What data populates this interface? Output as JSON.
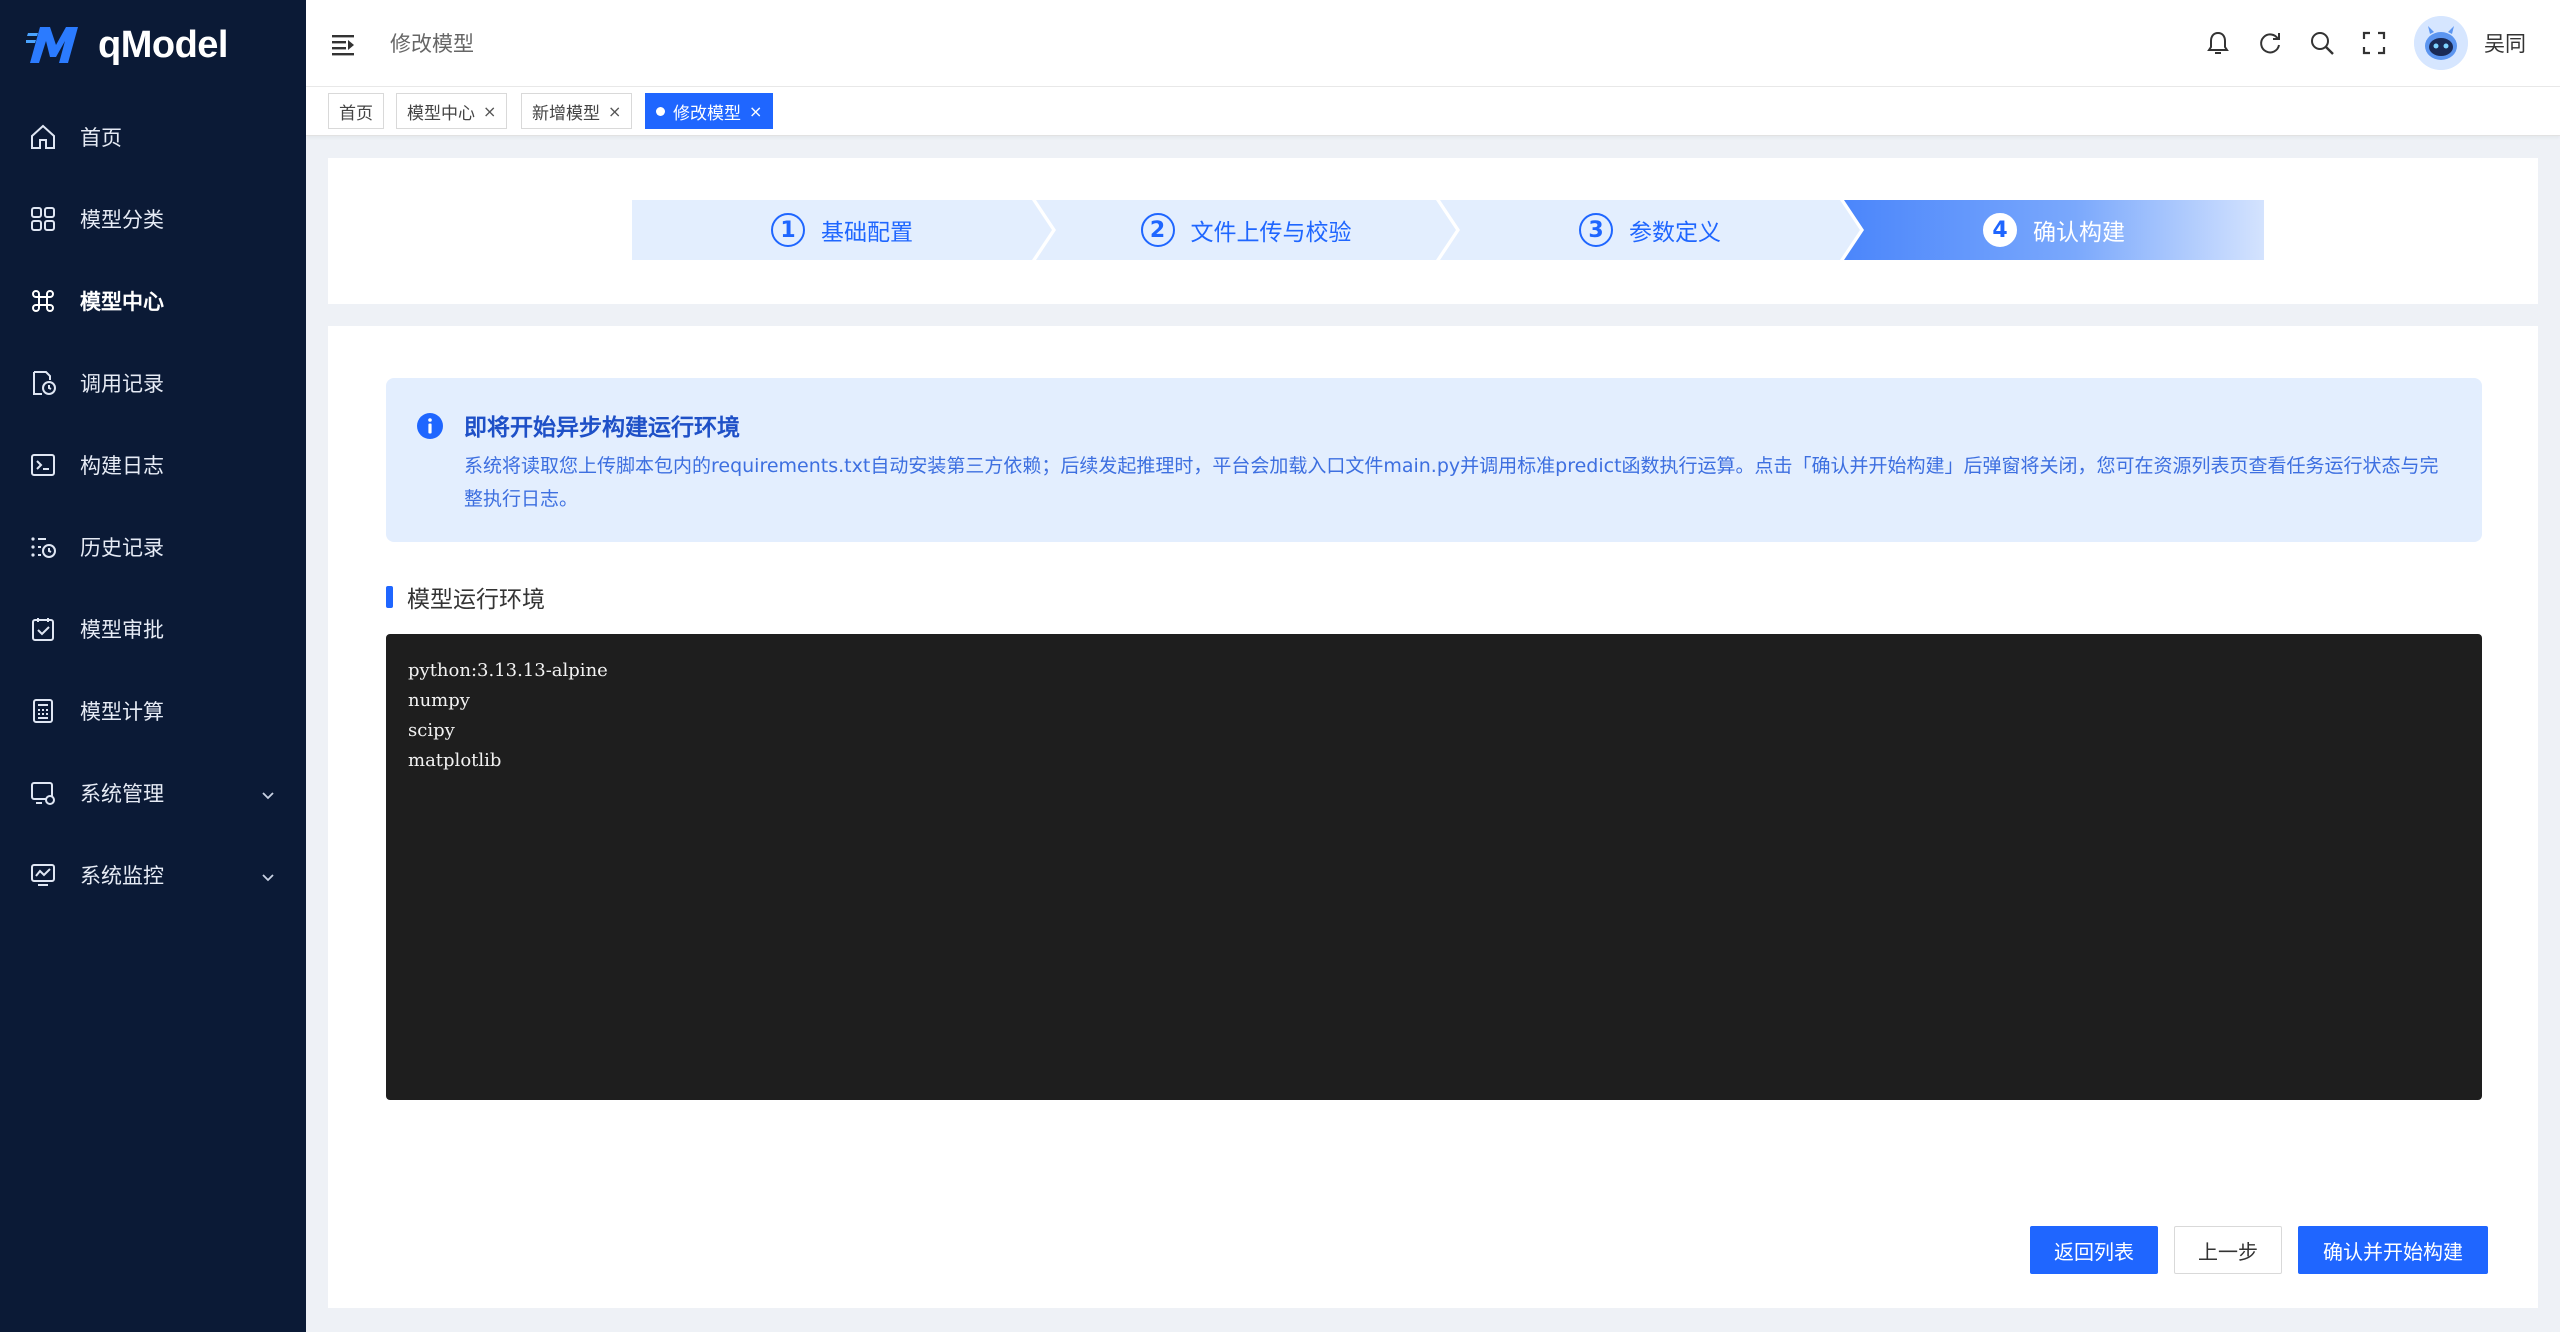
{
  "app": {
    "name": "qModel",
    "user": "吴同",
    "breadcrumb": "修改模型"
  },
  "sidebar": {
    "items": [
      {
        "label": "首页",
        "icon": "home-icon"
      },
      {
        "label": "模型分类",
        "icon": "grid-icon"
      },
      {
        "label": "模型中心",
        "icon": "command-icon",
        "active": true
      },
      {
        "label": "调用记录",
        "icon": "document-clock-icon"
      },
      {
        "label": "构建日志",
        "icon": "terminal-icon"
      },
      {
        "label": "历史记录",
        "icon": "history-list-icon"
      },
      {
        "label": "模型审批",
        "icon": "approval-icon"
      },
      {
        "label": "模型计算",
        "icon": "calculator-icon"
      },
      {
        "label": "系统管理",
        "icon": "system-settings-icon",
        "expandable": true
      },
      {
        "label": "系统监控",
        "icon": "monitor-icon",
        "expandable": true
      }
    ]
  },
  "tabs": [
    {
      "label": "首页",
      "closable": false
    },
    {
      "label": "模型中心",
      "closable": true
    },
    {
      "label": "新增模型",
      "closable": true
    },
    {
      "label": "修改模型",
      "closable": true,
      "active": true
    }
  ],
  "tab_close_glyph": "×",
  "steps": [
    {
      "number": "1",
      "label": "基础配置"
    },
    {
      "number": "2",
      "label": "文件上传与校验"
    },
    {
      "number": "3",
      "label": "参数定义"
    },
    {
      "number": "4",
      "label": "确认构建",
      "current": true
    }
  ],
  "alert": {
    "title": "即将开始异步构建运行环境",
    "description": "系统将读取您上传脚本包内的requirements.txt自动安装第三方依赖；后续发起推理时，平台会加载入口文件main.py并调用标准predict函数执行运算。点击「确认并开始构建」后弹窗将关闭，您可在资源列表页查看任务运行状态与完整执行日志。"
  },
  "section": {
    "title": "模型运行环境"
  },
  "environment_lines": [
    "python:3.13.13-alpine",
    "numpy",
    "scipy",
    "matplotlib"
  ],
  "buttons": {
    "back": "返回列表",
    "prev": "上一步",
    "confirm": "确认并开始构建"
  },
  "watermark": "qModel",
  "colors": {
    "primary": "#1f66ff",
    "sidebar_bg": "#0b1a36",
    "alert_bg": "#e3eefe",
    "code_bg": "#1e1e1e"
  }
}
